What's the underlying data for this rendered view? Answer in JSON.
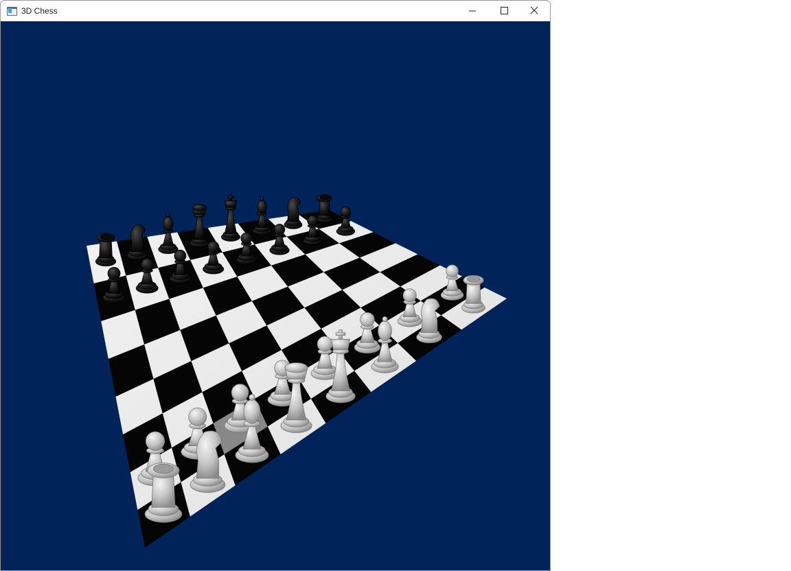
{
  "window": {
    "title": "3D Chess",
    "controls": [
      "minimize",
      "maximize",
      "close"
    ]
  },
  "scene": {
    "background": "#00235a",
    "board": {
      "light_square": "#f2f2f2",
      "dark_square": "#050505",
      "highlight_square": "#8e8e8e"
    },
    "pieces": {
      "white_color": "#c8c8c8",
      "black_color": "#1a1a1a"
    }
  }
}
